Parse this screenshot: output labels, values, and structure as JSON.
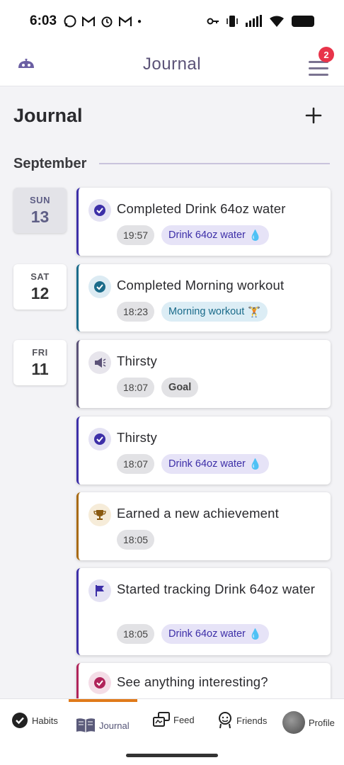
{
  "status_bar": {
    "time": "6:03",
    "left_icons": [
      "whatsapp-icon",
      "gmail-icon",
      "alarm-icon",
      "gmail-icon",
      "dot-icon"
    ],
    "right_icons": [
      "key-icon",
      "vibrate-icon",
      "signal-icon",
      "wifi-icon",
      "battery-icon"
    ]
  },
  "app_bar": {
    "title": "Journal",
    "notification_count": "2"
  },
  "page": {
    "heading": "Journal",
    "month": "September"
  },
  "dates": [
    {
      "dow": "SUN",
      "day": "13"
    },
    {
      "dow": "SAT",
      "day": "12"
    },
    {
      "dow": "FRI",
      "day": "11"
    }
  ],
  "entries": [
    {
      "icon": "check-circle-icon",
      "title": "Completed Drink 64oz water",
      "time": "19:57",
      "tag": "Drink 64oz water",
      "tag_emoji": "💧",
      "accent": "#3d2fa8"
    },
    {
      "icon": "check-circle-icon",
      "title": "Completed Morning workout",
      "time": "18:23",
      "tag": "Morning workout",
      "tag_emoji": "🏋️",
      "accent": "#1a6b8a"
    },
    {
      "icon": "megaphone-icon",
      "title": "Thirsty",
      "time": "18:07",
      "tag": "Goal",
      "tag_emoji": "",
      "accent": "#5b5277"
    },
    {
      "icon": "check-circle-icon",
      "title": "Thirsty",
      "time": "18:07",
      "tag": "Drink 64oz water",
      "tag_emoji": "💧",
      "accent": "#3d2fa8"
    },
    {
      "icon": "trophy-icon",
      "title": "Earned a new achievement",
      "time": "18:05",
      "tag": "",
      "tag_emoji": "",
      "accent": "#a86a12"
    },
    {
      "icon": "flag-icon",
      "title": "Started tracking Drink 64oz water",
      "time": "18:05",
      "tag": "Drink 64oz water",
      "tag_emoji": "💧",
      "accent": "#3d2fa8"
    },
    {
      "icon": "check-circle-icon",
      "title": "See anything interesting?",
      "time": "",
      "tag": "",
      "tag_emoji": "",
      "accent": "#b0245a"
    }
  ],
  "bottom_nav": {
    "habits": "Habits",
    "journal": "Journal",
    "feed": "Feed",
    "friends": "Friends",
    "profile": "Profile"
  },
  "colors": {
    "primary": "#3d2fa8",
    "nav_active_indicator": "#e07a1a",
    "badge": "#e8344a"
  }
}
